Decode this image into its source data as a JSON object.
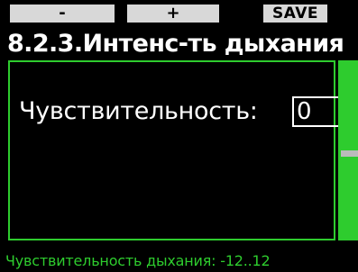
{
  "softkeys": {
    "minus_label": "-",
    "plus_label": "+",
    "save_label": "SAVE"
  },
  "title": "8.2.3.Интенс-ть дыхания",
  "setting": {
    "label": "Чувствительность:",
    "value": "0"
  },
  "footer": {
    "hint": "Чувствительность дыхания: -12..12"
  },
  "colors": {
    "accent": "#2ecc2e",
    "softkey_bg": "#d8d8d8",
    "background": "#000000",
    "scroll_thumb": "#bbbbbb"
  }
}
